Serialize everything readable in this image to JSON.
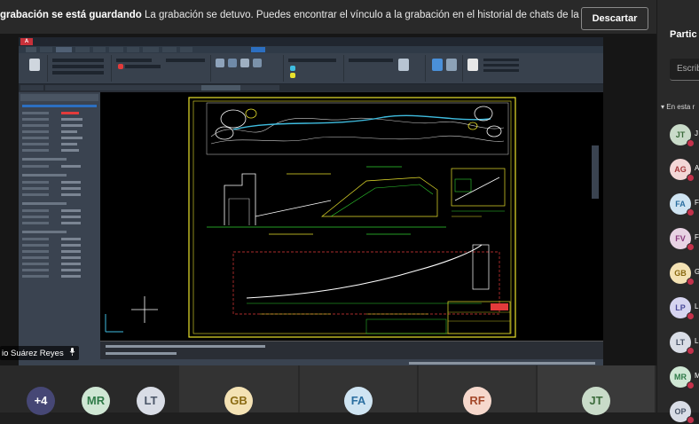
{
  "banner": {
    "title": "grabación se está guardando",
    "message": "La grabación se detuvo. Puedes encontrar el vínculo a la grabación en el historial de chats de la reunión. ...",
    "dismiss_label": "Descartar"
  },
  "shared_screen": {
    "presenter_name": "io Suárez Reyes",
    "app_icon": "autocad-logo",
    "app_logo_text": "A",
    "mic_icon": "microphone-icon"
  },
  "participants_panel": {
    "title": "Partic",
    "search_placeholder": "Escrib",
    "section_label": "En esta r",
    "list": [
      {
        "initials": "JT",
        "name": "J",
        "bg": "#c9dbc9",
        "fg": "#3b6b3b",
        "status": "#c4314b"
      },
      {
        "initials": "AG",
        "name": "A",
        "bg": "#f3d6d6",
        "fg": "#a4373a",
        "status": "#c4314b"
      },
      {
        "initials": "FA",
        "name": "F",
        "bg": "#cfe4f2",
        "fg": "#2a6ea0",
        "status": "#c4314b"
      },
      {
        "initials": "FV",
        "name": "F",
        "bg": "#e8d3e4",
        "fg": "#8a3a7e",
        "status": "#c4314b"
      },
      {
        "initials": "GB",
        "name": "G",
        "bg": "#f4e2b4",
        "fg": "#8a6a12",
        "status": "#c4314b"
      },
      {
        "initials": "LP",
        "name": "L",
        "bg": "#d6d4f0",
        "fg": "#4b4a9a",
        "status": "#c4314b"
      },
      {
        "initials": "LT",
        "name": "L",
        "bg": "#d9dde6",
        "fg": "#4a5568",
        "status": "#c4314b"
      },
      {
        "initials": "MR",
        "name": "M",
        "bg": "#cfe7d4",
        "fg": "#2e7a47",
        "status": "#c4314b"
      },
      {
        "initials": "OP",
        "name": "",
        "bg": "#d9dde6",
        "fg": "#4a5568",
        "status": "#c4314b"
      }
    ]
  },
  "video_tiles": [
    {
      "initials": "+4",
      "bg": "#464775",
      "fg": "#ffffff"
    },
    {
      "initials": "MR",
      "bg": "#cfe7d4",
      "fg": "#2e7a47"
    },
    {
      "initials": "LT",
      "bg": "#d9dde6",
      "fg": "#4a5568"
    },
    {
      "initials": "GB",
      "bg": "#f4e2b4",
      "fg": "#8a6a12"
    },
    {
      "initials": "FA",
      "bg": "#cfe4f2",
      "fg": "#2a6ea0"
    },
    {
      "initials": "RF",
      "bg": "#f6d8cc",
      "fg": "#a4482a"
    },
    {
      "initials": "JT",
      "bg": "#c9dbc9",
      "fg": "#3b6b3b"
    }
  ],
  "colors": {
    "drawing_green": "#2fd02f",
    "drawing_yellow": "#e8e12c",
    "drawing_red": "#e23b3b",
    "drawing_cyan": "#3fbde0"
  }
}
